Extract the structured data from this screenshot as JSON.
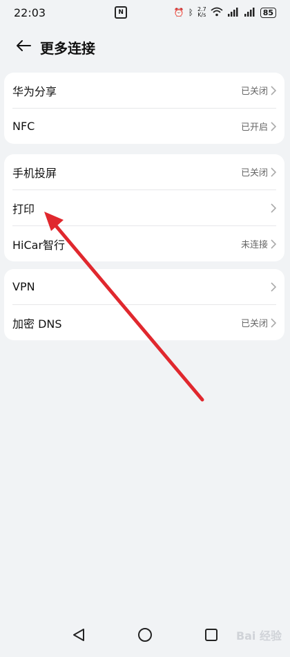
{
  "status": {
    "time": "22:03",
    "net_speed_top": "2.7",
    "net_speed_bottom": "K/s",
    "battery": "85"
  },
  "header": {
    "title": "更多连接"
  },
  "groups": [
    {
      "items": [
        {
          "label": "华为分享",
          "value": "已关闭"
        },
        {
          "label": "NFC",
          "value": "已开启"
        }
      ]
    },
    {
      "items": [
        {
          "label": "手机投屏",
          "value": "已关闭"
        },
        {
          "label": "打印",
          "value": ""
        },
        {
          "label": "HiCar智行",
          "value": "未连接"
        }
      ]
    },
    {
      "items": [
        {
          "label": "VPN",
          "value": ""
        },
        {
          "label": "加密 DNS",
          "value": "已关闭"
        }
      ]
    }
  ],
  "watermark": "Bai 经验",
  "colors": {
    "background": "#f1f3f5",
    "card": "#ffffff",
    "annotation_arrow": "#e0282e"
  },
  "icons": [
    "back-arrow-icon",
    "chevron-right-icon",
    "nav-back-icon",
    "nav-home-icon",
    "nav-recent-icon"
  ]
}
